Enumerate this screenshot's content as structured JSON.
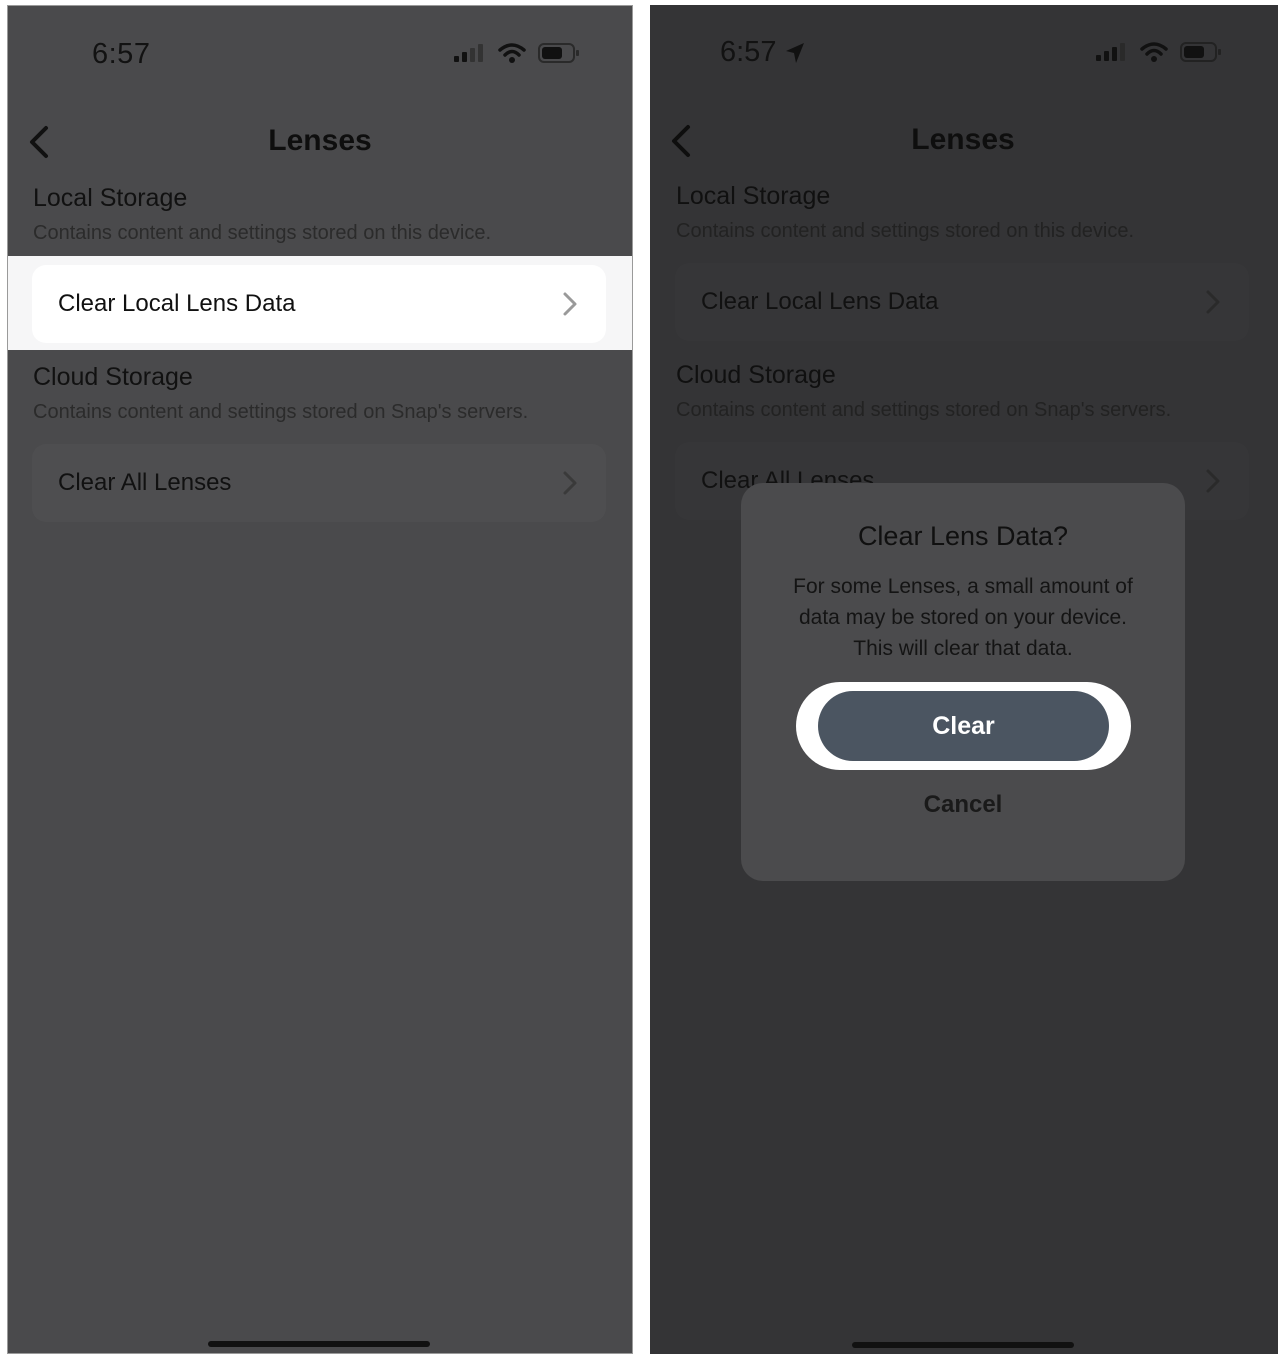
{
  "left": {
    "status": {
      "time": "6:57"
    },
    "header": {
      "title": "Lenses"
    },
    "local_storage": {
      "title": "Local Storage",
      "description": "Contains content and settings stored on this device.",
      "row_label": "Clear Local Lens Data"
    },
    "cloud_storage": {
      "title": "Cloud Storage",
      "description": "Contains content and settings stored on Snap's servers.",
      "row_label": "Clear All Lenses"
    }
  },
  "right": {
    "status": {
      "time": "6:57"
    },
    "header": {
      "title": "Lenses"
    },
    "local_storage": {
      "title": "Local Storage",
      "description": "Contains content and settings stored on this device.",
      "row_label": "Clear Local Lens Data"
    },
    "cloud_storage": {
      "title": "Cloud Storage",
      "description": "Contains content and settings stored on Snap's servers.",
      "row_label": "Clear All Lenses"
    },
    "dialog": {
      "title": "Clear Lens Data?",
      "body": "For some Lenses, a small amount of data may be stored on your device. This will clear that data.",
      "confirm_label": "Clear",
      "cancel_label": "Cancel"
    }
  },
  "colors": {
    "left_background": "#4a4a4c",
    "right_background": "#343436",
    "highlight": "#f6f6f7",
    "clear_button": "#4b5561"
  },
  "icons": [
    "back-chevron-icon",
    "chevron-right-icon",
    "signal-icon",
    "wifi-icon",
    "battery-icon",
    "location-arrow-icon"
  ]
}
